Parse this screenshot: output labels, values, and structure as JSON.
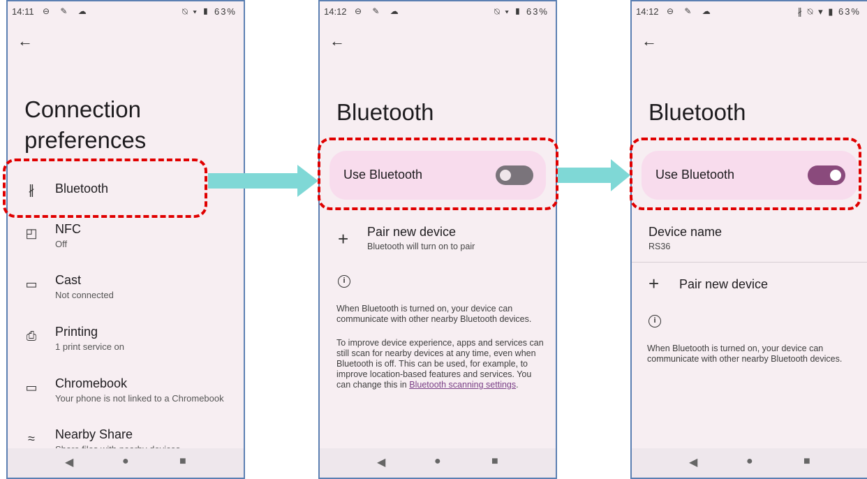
{
  "colors": {
    "frame_border": "#5b7fb2",
    "screen_bg": "#f7eef2",
    "highlight": "#e00000",
    "arrow": "#7fd8d6",
    "toggle_row_bg": "#f8dced",
    "switch_on": "#8a4a7c",
    "switch_off": "#7a747b",
    "link": "#7a3f86"
  },
  "screen1": {
    "time": "14:11",
    "status_icons": "⊖ ✎ ☁",
    "status_right": "⍉ ▾ ▮ 63%",
    "back_icon": "←",
    "title_line1": "Connection",
    "title_line2": "preferences",
    "items": [
      {
        "label": "Bluetooth",
        "sub": "",
        "icon": "bluetooth-icon",
        "glyph": "∦"
      },
      {
        "label": "NFC",
        "sub": "Off",
        "icon": "nfc-icon",
        "glyph": "◰"
      },
      {
        "label": "Cast",
        "sub": "Not connected",
        "icon": "cast-icon",
        "glyph": "▭"
      },
      {
        "label": "Printing",
        "sub": "1 print service on",
        "icon": "print-icon",
        "glyph": "⎙"
      },
      {
        "label": "Chromebook",
        "sub": "Your phone is not linked to a Chromebook",
        "icon": "chromebook-icon",
        "glyph": "▭"
      },
      {
        "label": "Nearby Share",
        "sub": "Share files with nearby devices",
        "icon": "nearby-share-icon",
        "glyph": "≈"
      }
    ]
  },
  "screen2": {
    "time": "14:12",
    "status_icons": "⊖ ✎ ☁",
    "status_right": "⍉ ▾ ▮ 63%",
    "back_icon": "←",
    "title": "Bluetooth",
    "toggle_label": "Use Bluetooth",
    "toggle_on": false,
    "pair_label": "Pair new device",
    "pair_sub": "Bluetooth will turn on to pair",
    "info_text_1": "When Bluetooth is turned on, your device can communicate with other nearby Bluetooth devices.",
    "info_text_2_prefix": "To improve device experience, apps and services can still scan for nearby devices at any time, even when Bluetooth is off. This can be used, for example, to improve location-based features and services. You can change this in ",
    "info_link": "Bluetooth scanning settings",
    "info_text_2_suffix": "."
  },
  "screen3": {
    "time": "14:12",
    "status_icons": "⊖ ✎ ☁",
    "status_right": "∦ ⍉ ▾ ▮ 63%",
    "back_icon": "←",
    "title": "Bluetooth",
    "toggle_label": "Use Bluetooth",
    "toggle_on": true,
    "device_name_label": "Device name",
    "device_name_value": "RS36",
    "pair_label": "Pair new device",
    "info_text_1": "When Bluetooth is turned on, your device can communicate with other nearby Bluetooth devices."
  },
  "navbar": {
    "back": "◀",
    "home": "●",
    "recent": "■"
  }
}
